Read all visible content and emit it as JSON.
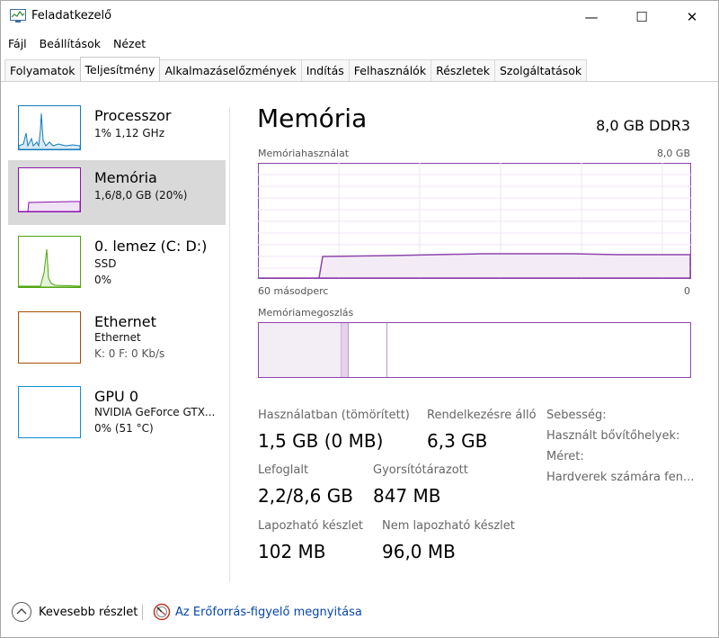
{
  "window": {
    "title": "Feladatkezelő",
    "controls": {
      "minimize": "—",
      "maximize": "☐",
      "close": "✕"
    }
  },
  "menu": [
    "Fájl",
    "Beállítások",
    "Nézet"
  ],
  "tabs": [
    {
      "label": "Folyamatok",
      "active": false
    },
    {
      "label": "Teljesítmény",
      "active": true
    },
    {
      "label": "Alkalmazáselőzmények",
      "active": false
    },
    {
      "label": "Indítás",
      "active": false
    },
    {
      "label": "Felhasználók",
      "active": false
    },
    {
      "label": "Részletek",
      "active": false
    },
    {
      "label": "Szolgáltatások",
      "active": false
    }
  ],
  "sidebar": {
    "items": [
      {
        "title": "Processzor",
        "line1": "1% 1,12 GHz",
        "line2": "",
        "color": "#117dbb"
      },
      {
        "title": "Memória",
        "line1": "1,6/8,0 GB (20%)",
        "line2": "",
        "color": "#8b12ae"
      },
      {
        "title": "0. lemez (C: D:)",
        "line1": "SSD",
        "line2": "0%",
        "color": "#4da60c"
      },
      {
        "title": "Ethernet",
        "line1": "Ethernet",
        "line2": "K: 0 F: 0 Kb/s",
        "color": "#a74f01"
      },
      {
        "title": "GPU 0",
        "line1": "NVIDIA GeForce GTX...",
        "line2": "0% (51 °C)",
        "color": "#0a8fd6"
      }
    ]
  },
  "main": {
    "title": "Memória",
    "spec": "8,0 GB DDR3",
    "usage_label": "Memóriahasználat",
    "usage_max": "8,0 GB",
    "axis_left": "60 másodperc",
    "axis_right": "0",
    "composition_label": "Memóriamegoszlás",
    "usage_accent": "#8e44ad",
    "stats": {
      "in_use_label": "Használatban (tömörített)",
      "in_use_value": "1,5 GB (0 MB)",
      "available_label": "Rendelkezésre álló",
      "available_value": "6,3 GB",
      "committed_label": "Lefoglalt",
      "committed_value": "2,2/8,6 GB",
      "cached_label": "Gyorsítótárazott",
      "cached_value": "847 MB",
      "paged_label": "Lapozható készlet",
      "paged_value": "102 MB",
      "nonpaged_label": "Nem lapozható készlet",
      "nonpaged_value": "96,0 MB"
    },
    "props": {
      "speed": "Sebesség:",
      "slots": "Használt bővítőhelyek:",
      "form": "Méret:",
      "reserved": "Hardverek számára fen..."
    }
  },
  "footer": {
    "fewer_details": "Kevesebb részlet",
    "resource_monitor": "Az Erőforrás-figyelő megnyitása"
  }
}
